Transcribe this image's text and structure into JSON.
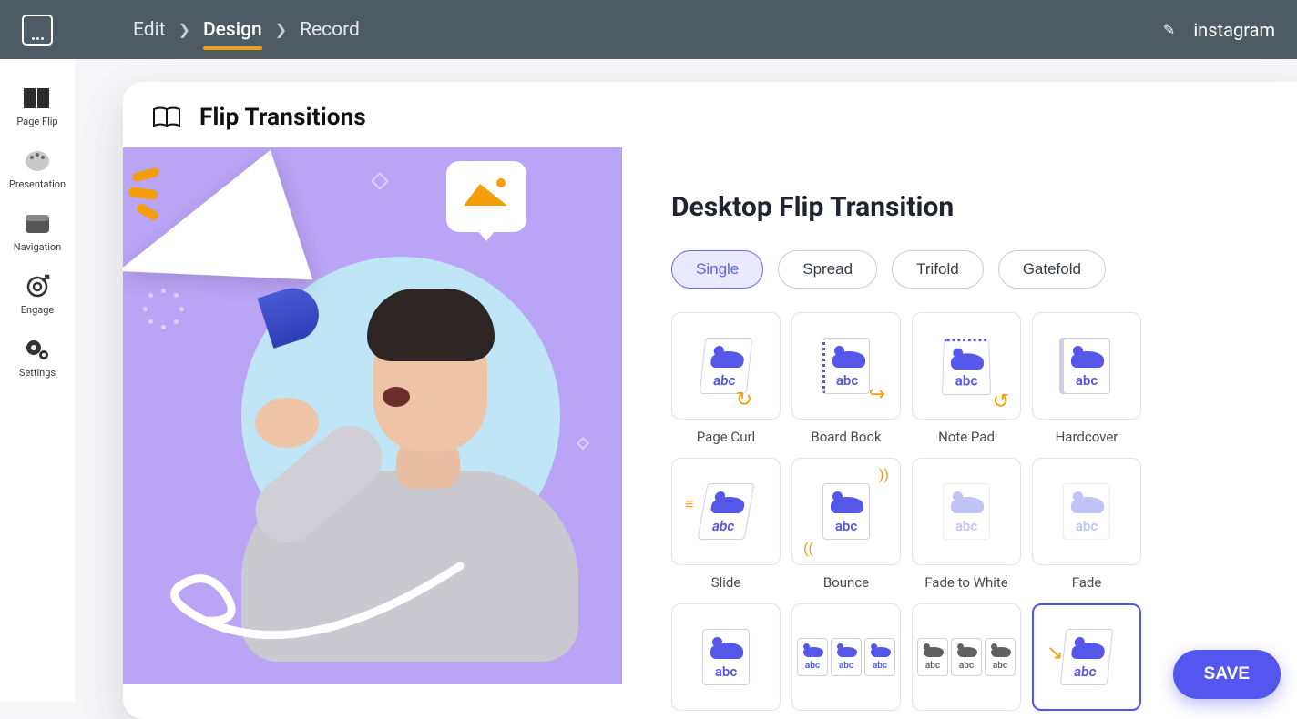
{
  "topbar": {
    "breadcrumb": [
      "Edit",
      "Design",
      "Record"
    ],
    "active_index": 1,
    "right_label": "instagram"
  },
  "sidebar": {
    "items": [
      {
        "label": "Page Flip"
      },
      {
        "label": "Presentation"
      },
      {
        "label": "Navigation"
      },
      {
        "label": "Engage"
      },
      {
        "label": "Settings"
      }
    ]
  },
  "panel": {
    "title": "Flip Transitions",
    "section_title": "Desktop Flip Transition",
    "tabs": [
      "Single",
      "Spread",
      "Trifold",
      "Gatefold"
    ],
    "active_tab": 0,
    "transitions": [
      "Page Curl",
      "Board Book",
      "Note Pad",
      "Hardcover",
      "Slide",
      "Bounce",
      "Fade to White",
      "Fade",
      "",
      "",
      "",
      ""
    ],
    "selected_index": 11,
    "save_label": "SAVE"
  }
}
